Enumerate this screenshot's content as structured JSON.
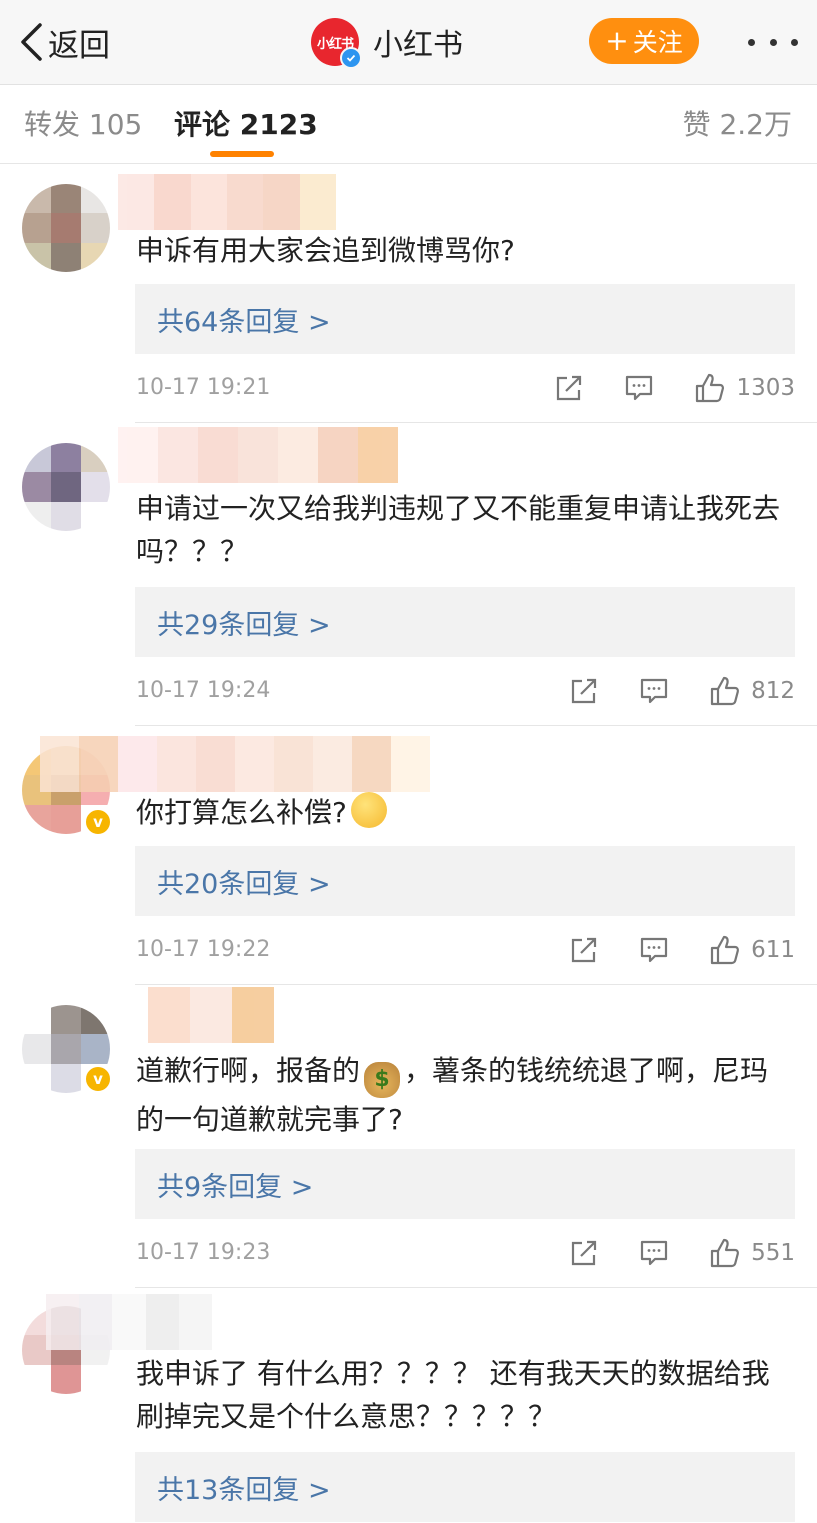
{
  "header": {
    "back_label": "返回",
    "logo_text": "小红书",
    "title": "小红书",
    "follow_label": "关注",
    "follow_color": "#ff8f0f"
  },
  "tabs": {
    "repost": "转发 105",
    "comment": "评论 2123",
    "like": "赞 2.2万",
    "indicator_color": "#ff8200"
  },
  "icons": {
    "back": "chevron-left-icon",
    "share": "share-icon",
    "reply": "comment-icon",
    "like": "thumb-up-icon",
    "more": "more-dots-icon",
    "verified": "verified-badge-icon"
  },
  "comments": [
    {
      "text": "申诉有用大家会追到微博骂你?",
      "replies": "共64条回复 >",
      "time": "10-17 19:21",
      "likes": "1303"
    },
    {
      "text": "申请过一次又给我判违规了又不能重复申请让我死去吗？？？",
      "replies": "共29条回复 >",
      "time": "10-17 19:24",
      "likes": "812"
    },
    {
      "text": "你打算怎么补偿?",
      "replies": "共20条回复 >",
      "time": "10-17 19:22",
      "likes": "611"
    },
    {
      "text_a": "道歉行啊，报备的",
      "text_b": "，薯条的钱统统退了啊，尼玛的一句道歉就完事了?",
      "replies": "共9条回复 >",
      "time": "10-17 19:23",
      "likes": "551"
    },
    {
      "text": "我申诉了 有什么用？？？？ 还有我天天的数据给我刷掉完又是个什么意思？？？？？",
      "replies": "共13条回复 >"
    }
  ]
}
